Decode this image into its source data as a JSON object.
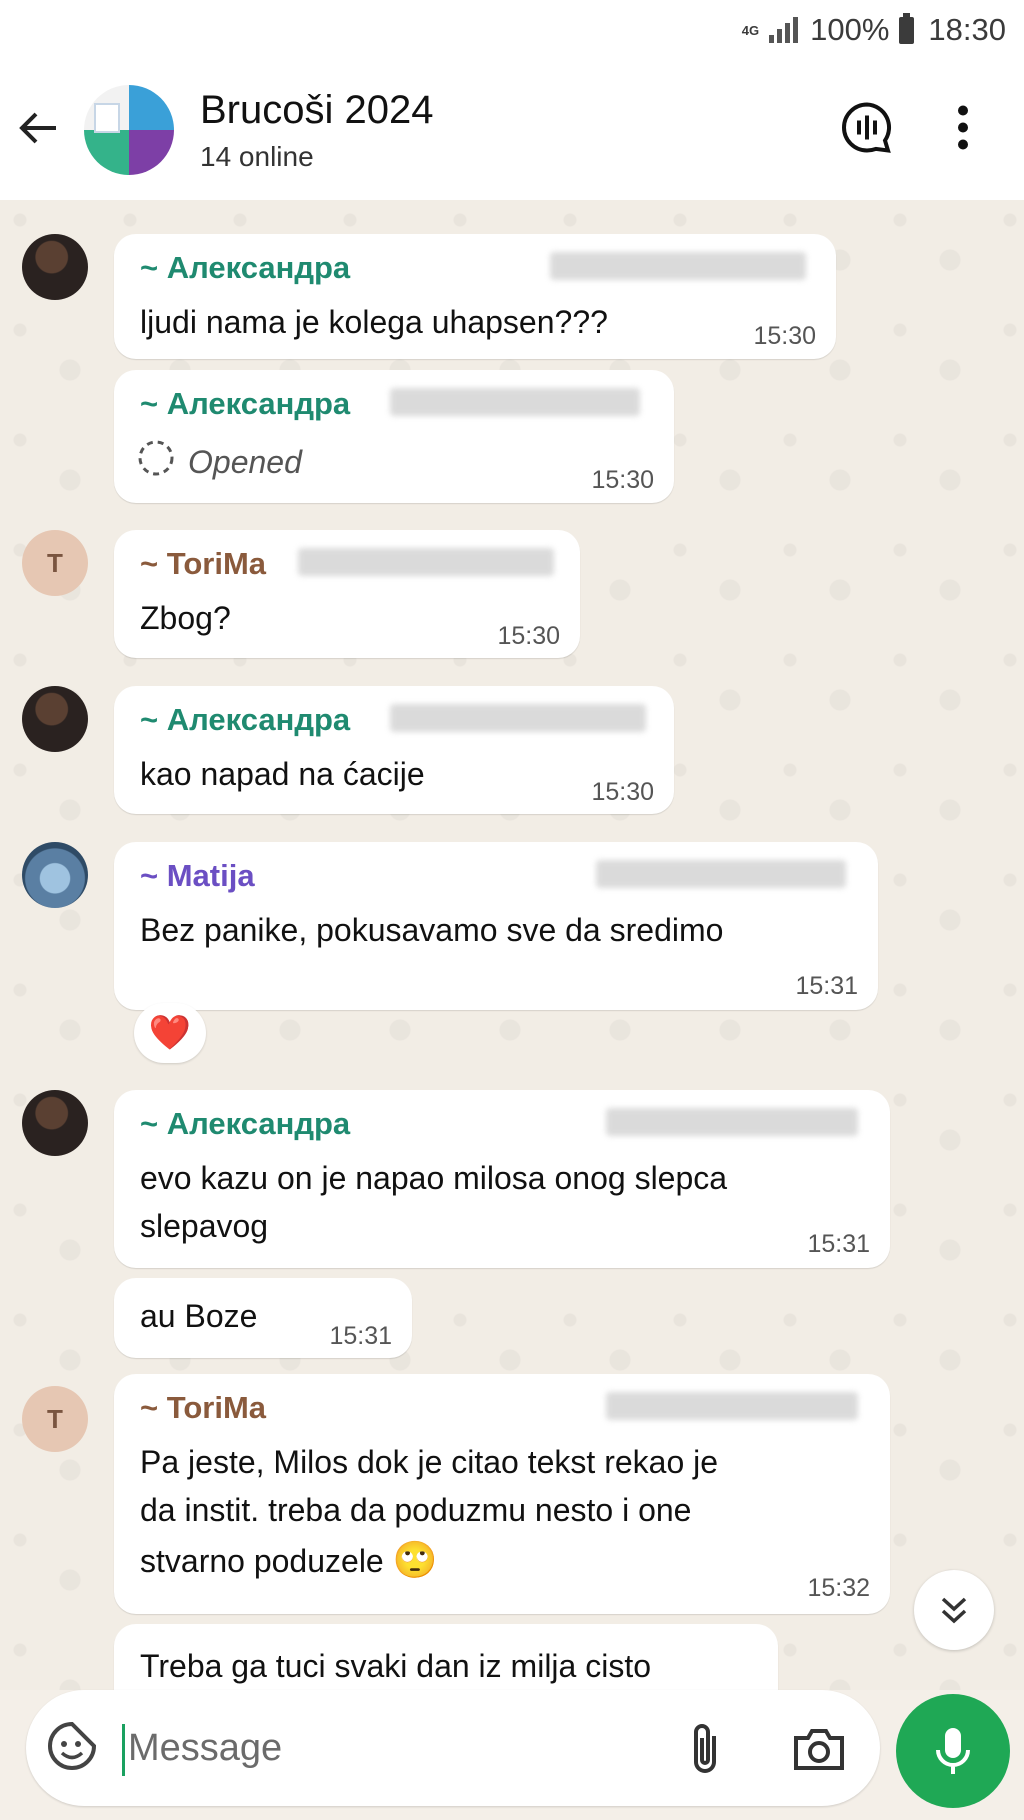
{
  "status_bar": {
    "network": "4G",
    "battery": "100%",
    "time": "18:30"
  },
  "header": {
    "title": "Brucoši 2024",
    "subtitle": "14 online"
  },
  "messages": [
    {
      "sender": "~ Александра",
      "text": "ljudi nama je kolega uhapsen???",
      "time": "15:30"
    },
    {
      "sender": "~ Александра",
      "text": "Opened",
      "time": "15:30"
    },
    {
      "sender": "~ ToriMa",
      "avatar_letter": "T",
      "text": "Zbog?",
      "time": "15:30"
    },
    {
      "sender": "~ Александра",
      "text": "kao napad na ćacije",
      "time": "15:30"
    },
    {
      "sender": "~ Matija",
      "text": "Bez panike, pokusavamo sve da sredimo",
      "time": "15:31",
      "reaction": "❤️"
    },
    {
      "sender": "~ Александра",
      "text_line1": "evo kazu on je napao milosa onog slepca",
      "text_line2": "slepavog",
      "time": "15:31"
    },
    {
      "text": "au Boze",
      "time": "15:31"
    },
    {
      "sender": "~ ToriMa",
      "avatar_letter": "T",
      "text_line1": "Pa jeste, Milos dok je citao tekst rekao je",
      "text_line2": "da instit. treba da poduzmu nesto i one",
      "text_line3": "stvarno poduzele",
      "emoji": "🙄",
      "time": "15:32"
    },
    {
      "text": "Treba ga tuci svaki dan iz milja cisto"
    }
  ],
  "composer": {
    "placeholder": "Message"
  },
  "colors": {
    "accent_green": "#1fa855",
    "sender_green": "#1f8a70",
    "sender_purple": "#6b4fc3",
    "sender_brown": "#8a5a3c"
  },
  "icons": [
    "back-arrow-icon",
    "voice-chat-icon",
    "more-vertical-icon",
    "sticker-icon",
    "attach-icon",
    "camera-icon",
    "mic-icon",
    "chevron-double-down-icon",
    "loading-circle-icon"
  ]
}
